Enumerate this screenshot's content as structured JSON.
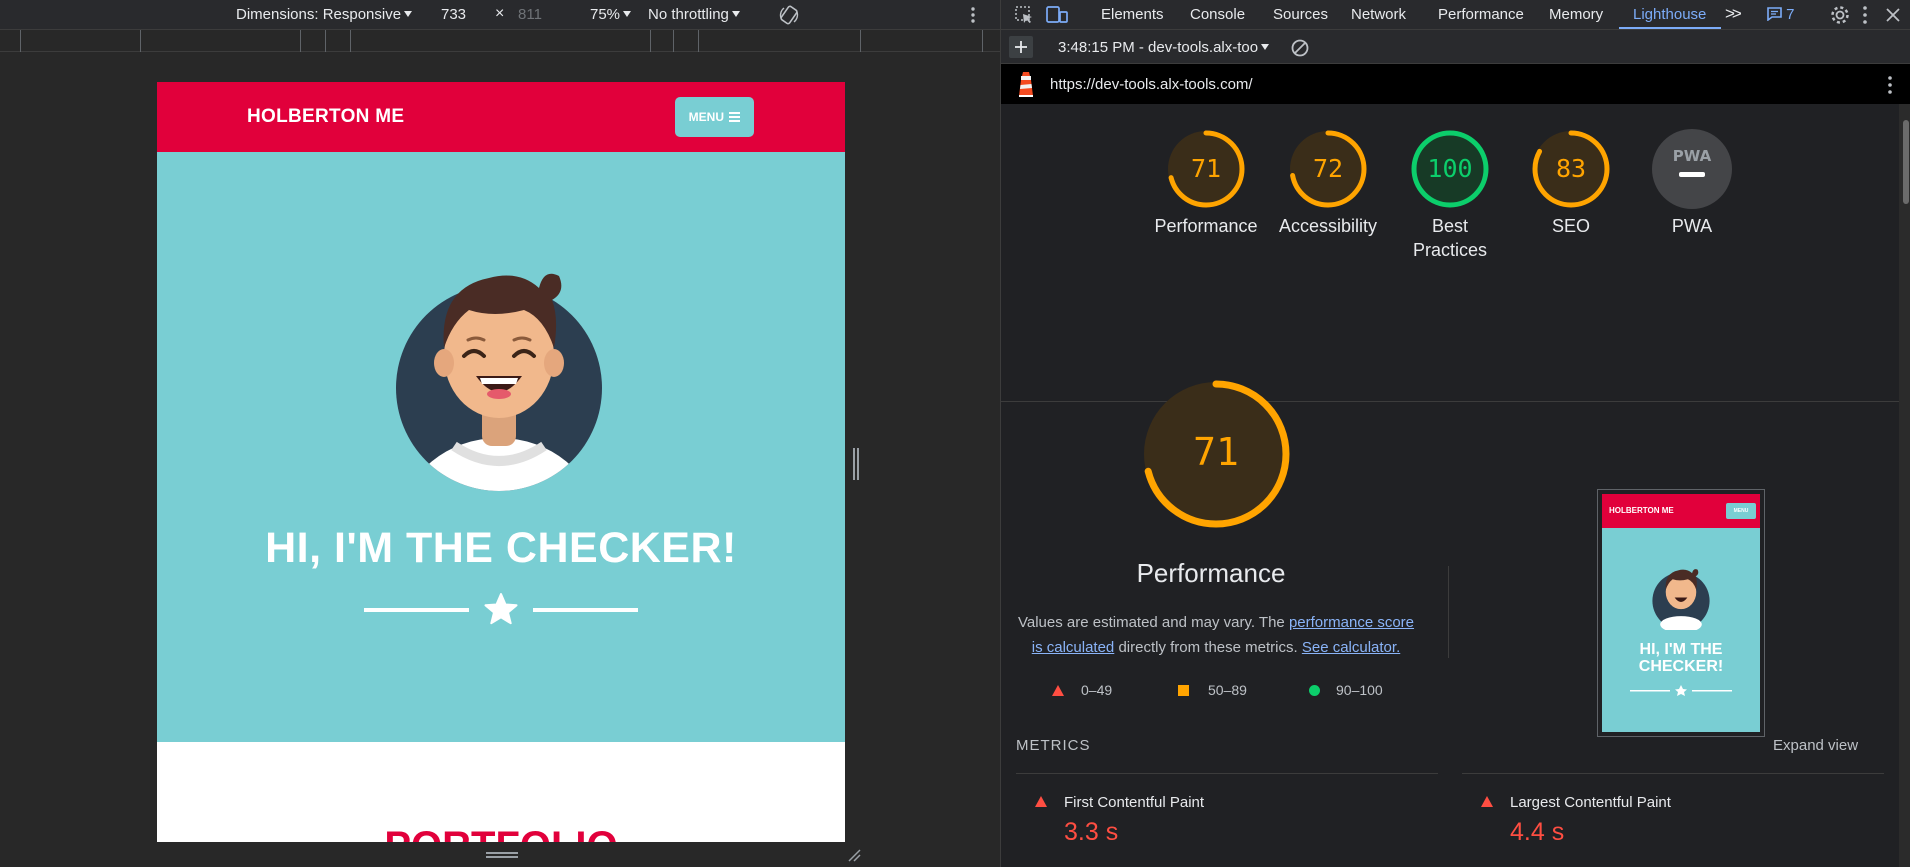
{
  "device_toolbar": {
    "dimensions_label": "Dimensions: Responsive",
    "width": "733",
    "times": "×",
    "height": "811",
    "zoom": "75%",
    "throttling": "No throttling"
  },
  "site": {
    "logo": "HOLBERTON ME",
    "menu_label": "MENU",
    "hero_title": "HI, I'M THE CHECKER!",
    "portfolio_title": "PORTFOLIO"
  },
  "devtools": {
    "tabs": [
      "Elements",
      "Console",
      "Sources",
      "Network",
      "Performance",
      "Memory",
      "Lighthouse"
    ],
    "active_tab": "Lighthouse",
    "issues_count": "7",
    "report_label": "3:48:15 PM - dev-tools.alx-too",
    "url": "https://dev-tools.alx-tools.com/"
  },
  "scores": [
    {
      "label": "Performance",
      "value": 71,
      "color": "#ffa400"
    },
    {
      "label": "Accessibility",
      "value": 72,
      "color": "#ffa400"
    },
    {
      "label_line1": "Best",
      "label_line2": "Practices",
      "value": 100,
      "color": "#0cce6b"
    },
    {
      "label": "SEO",
      "value": 83,
      "color": "#ffa400"
    }
  ],
  "pwa": {
    "label": "PWA",
    "badge": "PWA"
  },
  "performance": {
    "score": 71,
    "title": "Performance",
    "desc_1": "Values are estimated and may vary. The",
    "desc_link1": "performance score is calculated",
    "desc_2": "directly from these metrics.",
    "desc_link2": "See calculator.",
    "legend": [
      "0–49",
      "50–89",
      "90–100"
    ]
  },
  "thumbnail": {
    "logo": "HOLBERTON ME",
    "menu": "MENU",
    "title_line1": "HI, I'M THE",
    "title_line2": "CHECKER!"
  },
  "metrics": {
    "header": "METRICS",
    "expand": "Expand view",
    "items": [
      {
        "name": "First Contentful Paint",
        "value": "3.3 s"
      },
      {
        "name": "Largest Contentful Paint",
        "value": "4.4 s"
      }
    ]
  },
  "colors": {
    "brand_red": "#e1003b",
    "brand_teal": "#79ced3",
    "lh_orange": "#ffa400",
    "lh_green": "#0cce6b",
    "lh_red": "#ff4e42"
  }
}
